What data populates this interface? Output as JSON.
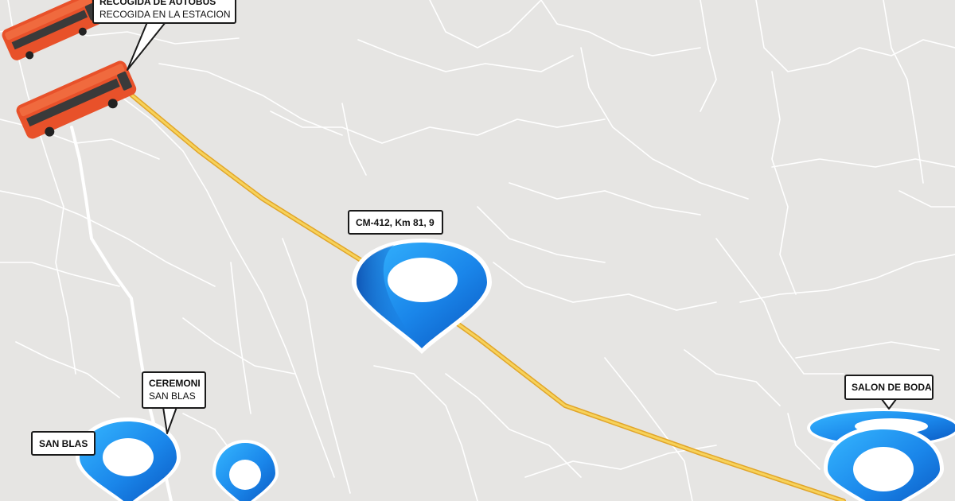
{
  "colors": {
    "map_background": "#e6e5e3",
    "road_minor": "#ffffff",
    "route_line": "#f3c23e",
    "route_outline": "#e1a52a",
    "pin_light": "#2ea8ff",
    "pin_dark": "#0a5fc7",
    "bus_body": "#e8512a",
    "bus_window": "#3a3a3a"
  },
  "labels": {
    "bus_stop": {
      "title": "RECOGIDA DE AUTOBUS",
      "subtitle": "RECOGIDA EN LA ESTACION"
    },
    "waypoint": {
      "title": "CM-412, Km 81, 9"
    },
    "ceremony": {
      "title": "CEREMONI",
      "subtitle": "SAN BLAS"
    },
    "san_blas": {
      "title": "SAN BLAS"
    },
    "venue": {
      "title": "SALON DE BODA"
    }
  },
  "icons": {
    "bus": "bus-icon",
    "pin": "location-pin-icon"
  }
}
